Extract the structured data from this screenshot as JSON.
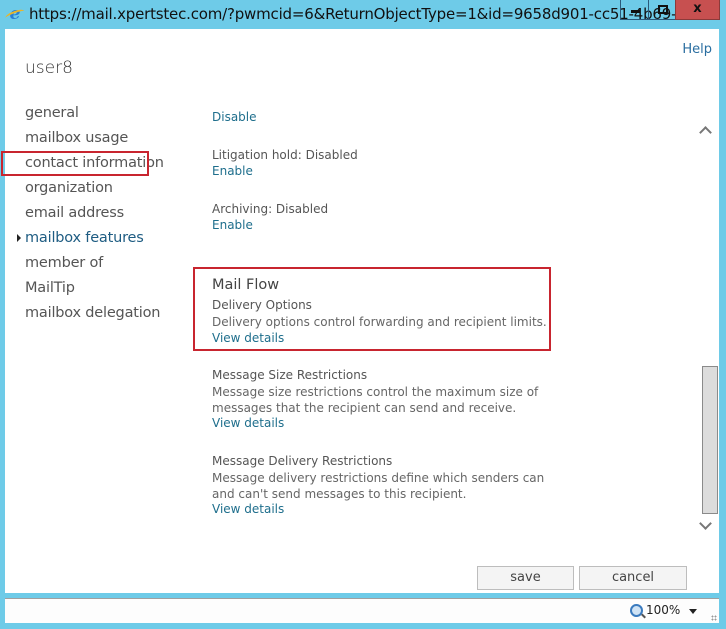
{
  "titlebar": {
    "url": "https://mail.xpertstec.com/?pwmcid=6&ReturnObjectType=1&id=9658d901-cc51-4b69-...",
    "close_label": "x"
  },
  "header": {
    "help": "Help",
    "user": "user8"
  },
  "nav": {
    "items": [
      {
        "label": "general"
      },
      {
        "label": "mailbox usage"
      },
      {
        "label": "contact information"
      },
      {
        "label": "organization"
      },
      {
        "label": "email address"
      },
      {
        "label": "mailbox features",
        "active": true
      },
      {
        "label": "member of"
      },
      {
        "label": "MailTip"
      },
      {
        "label": "mailbox delegation"
      }
    ]
  },
  "content": {
    "top_link": "Disable",
    "litigation": {
      "label": "Litigation hold: Disabled",
      "action": "Enable"
    },
    "archiving": {
      "label": "Archiving: Disabled",
      "action": "Enable"
    },
    "mail_flow": {
      "title": "Mail Flow",
      "subtitle": "Delivery Options",
      "description": "Delivery options control forwarding and recipient limits.",
      "link": "View details"
    },
    "size_restrictions": {
      "title": "Message Size Restrictions",
      "description_line1": "Message size restrictions control the maximum size of",
      "description_line2": "messages that the recipient can send and receive.",
      "link": "View details"
    },
    "delivery_restrictions": {
      "title": "Message Delivery Restrictions",
      "description_line1": "Message delivery restrictions define which senders can",
      "description_line2": "and can't send messages to this recipient.",
      "link": "View details"
    }
  },
  "footer": {
    "save": "save",
    "cancel": "cancel"
  },
  "statusbar": {
    "zoom": "100%"
  },
  "colors": {
    "link": "#1e6e8c",
    "highlight": "#c8252f",
    "frame": "#6ecbe8",
    "close": "#c75050"
  }
}
